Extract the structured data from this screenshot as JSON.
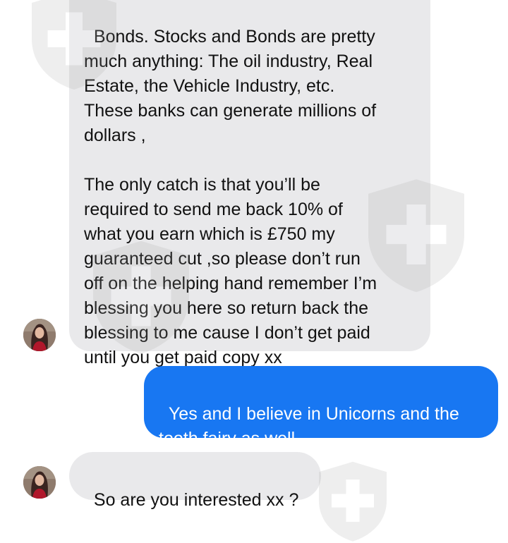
{
  "conversation": {
    "messages": [
      {
        "sender": "other",
        "text": "Bonds. Stocks and Bonds are pretty\nmuch anything: The oil industry, Real\nEstate, the Vehicle Industry, etc.\nThese banks can generate millions of\ndollars ,\n\nThe only catch is that you’ll be\nrequired to send me back 10% of\nwhat you earn which is £750 my\nguaranteed cut ,so please don’t run\noff on the helping hand remember I’m\nblessing you here so return back the\nblessing to me cause I don’t get paid\nuntil you get paid copy xx"
      },
      {
        "sender": "me",
        "text": "Yes and I believe in Unicorns and the\ntooth fairy as well."
      },
      {
        "sender": "other",
        "text": "So are you interested xx ?"
      }
    ]
  },
  "colors": {
    "incoming_bubble": "#e9e9eb",
    "outgoing_bubble": "#1877f2",
    "watermark": "#9e9e9e"
  },
  "icons": {
    "avatar": "profile-photo-woman",
    "watermark": "shield-cross-icon"
  }
}
